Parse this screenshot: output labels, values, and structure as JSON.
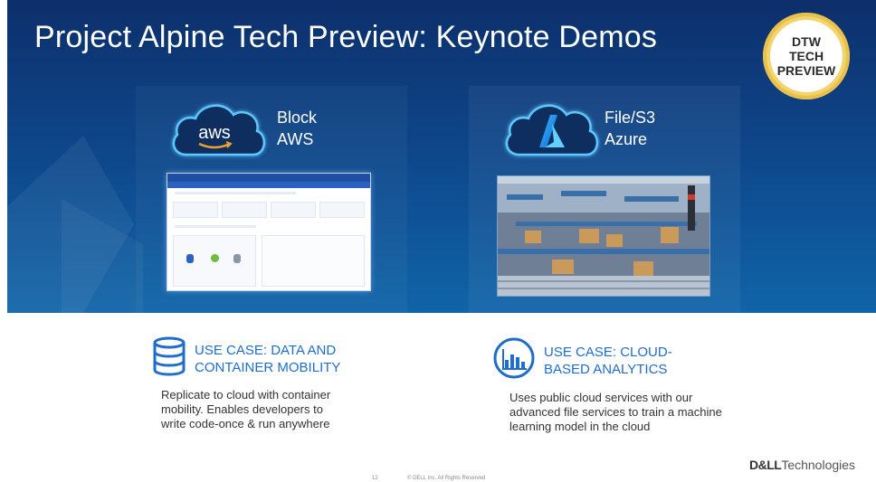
{
  "slide": {
    "title": "Project Alpine Tech Preview: Keynote Demos",
    "badge": [
      "DTW",
      "TECH",
      "PREVIEW"
    ],
    "page_number": "12",
    "copyright": "© DELL Inc. All Rights Reserved",
    "brand_bold": "D&LL",
    "brand_light": "Technologies"
  },
  "left": {
    "cloud_text": "aws",
    "label_line1": "Block",
    "label_line2": "AWS",
    "use_case_title_line1": "USE CASE: DATA AND",
    "use_case_title_line2": "CONTAINER MOBILITY",
    "body_line1": "Replicate to cloud with container",
    "body_line2": "mobility. Enables developers to",
    "body_line3": "write code-once & run anywhere",
    "icon": "database-icon"
  },
  "right": {
    "label_line1": "File/S3",
    "label_line2": "Azure",
    "use_case_title_line1": "USE CASE: CLOUD-",
    "use_case_title_line2": "BASED ANALYTICS",
    "body_line1": "Uses public cloud services with our",
    "body_line2": "advanced file services to train a machine",
    "body_line3": "learning model in the cloud",
    "icon": "analytics-chart-icon"
  },
  "colors": {
    "accent": "#1f6ec9",
    "hero_dark": "#0d2f6b",
    "badge_gold": "#f3d36b"
  }
}
